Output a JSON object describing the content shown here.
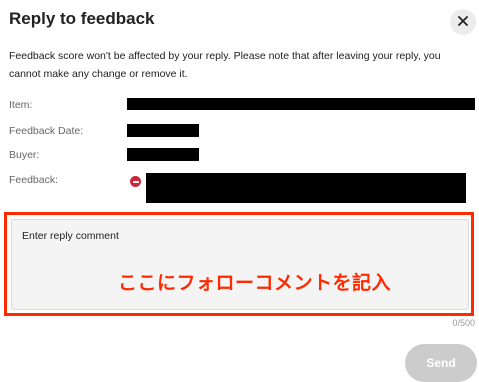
{
  "dialog": {
    "title": "Reply to feedback",
    "close_icon": "close-icon",
    "notice": "Feedback score won't be affected by your reply. Please note that after leaving your reply, you cannot make any change or remove it."
  },
  "details": {
    "item_label": "Item:",
    "date_label": "Feedback Date:",
    "buyer_label": "Buyer:",
    "feedback_label": "Feedback:",
    "feedback_rating_icon": "negative-rating-icon"
  },
  "reply": {
    "placeholder": "Enter reply comment",
    "annotation": "ここにフォローコメントを記入",
    "counter": "0/500"
  },
  "actions": {
    "send_label": "Send"
  },
  "colors": {
    "annotation": "#ff2a00",
    "negative_icon": "#d0243a",
    "send_disabled": "#cccccc"
  }
}
